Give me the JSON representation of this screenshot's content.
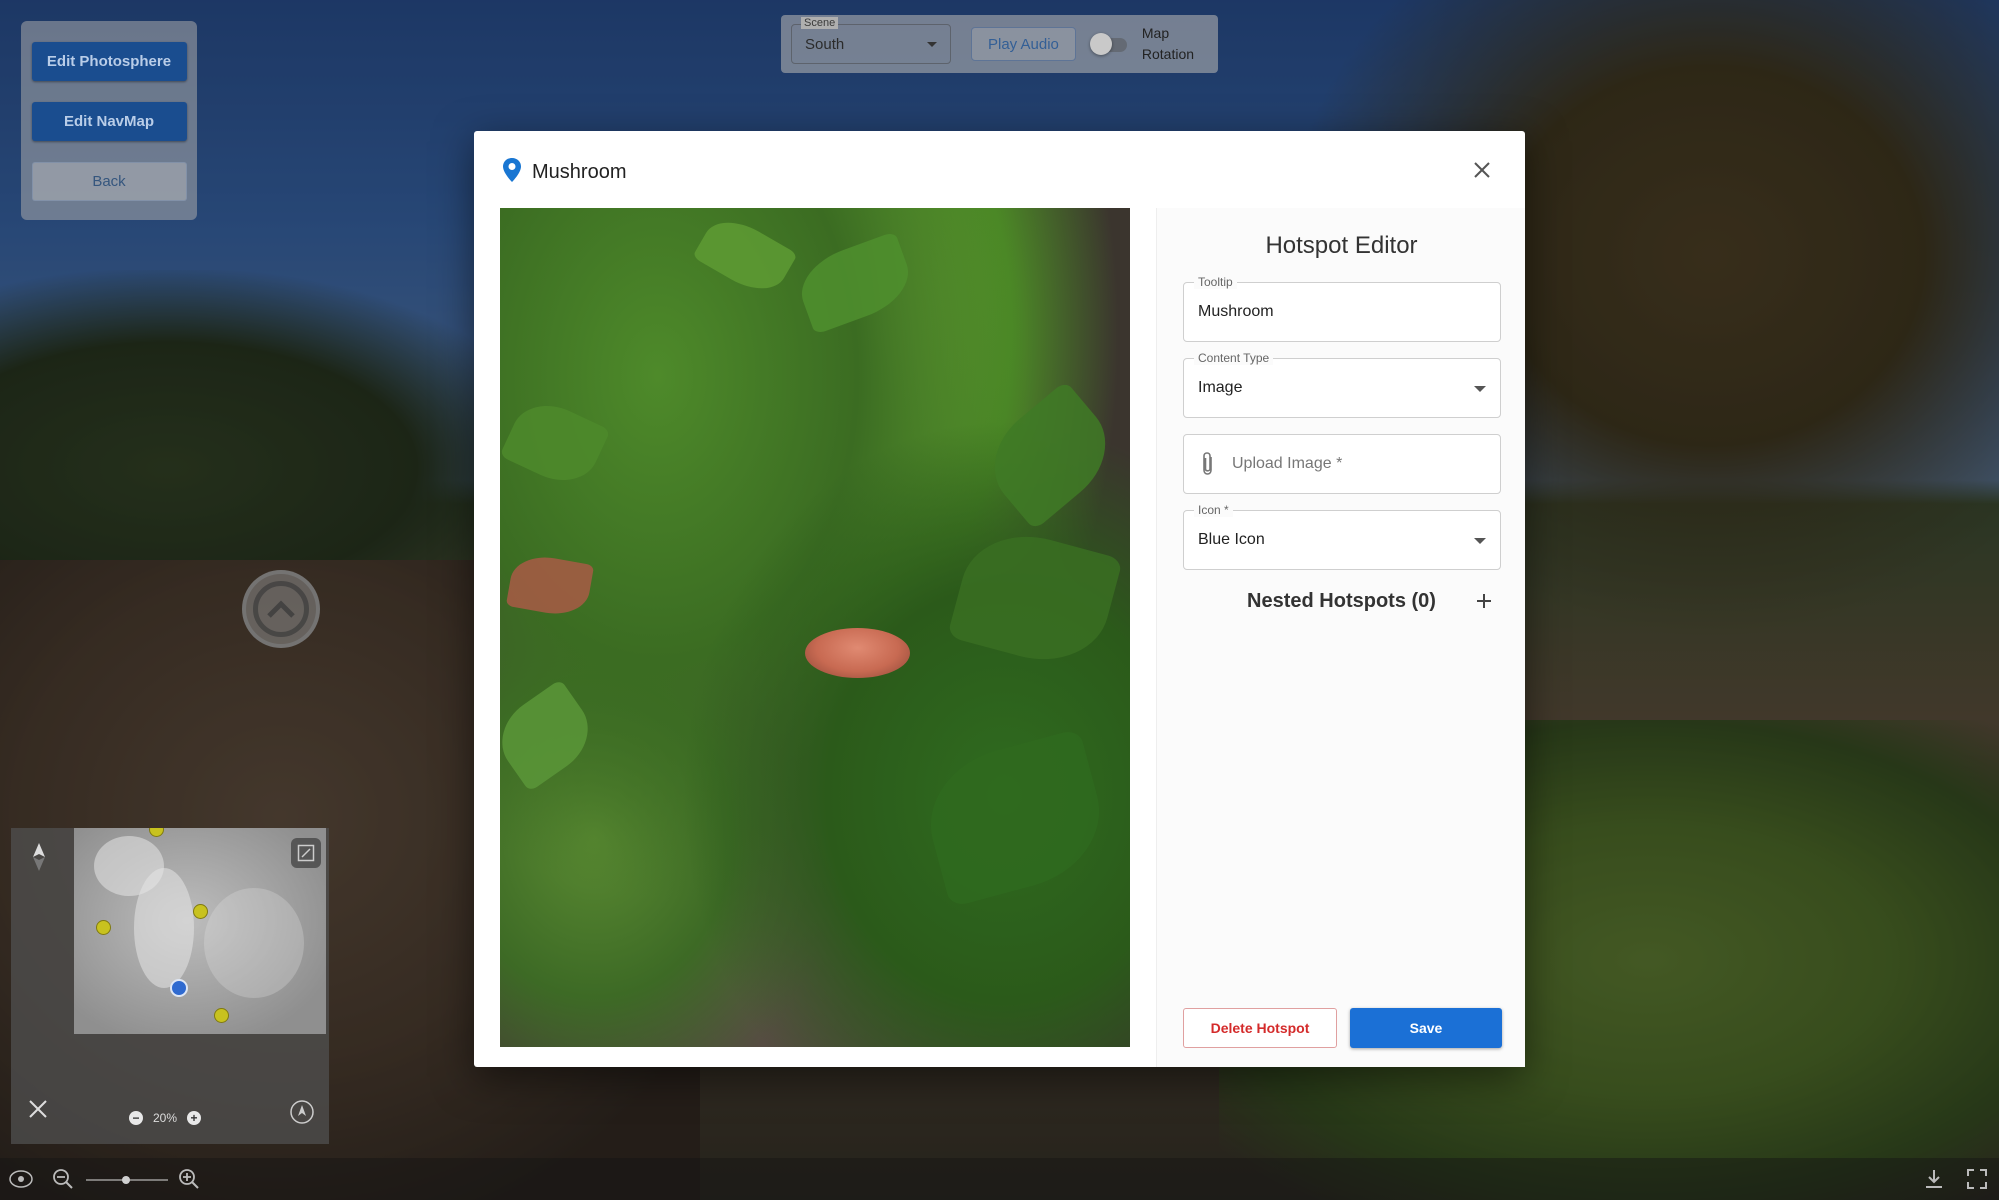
{
  "left_panel": {
    "edit_photosphere": "Edit Photosphere",
    "edit_navmap": "Edit NavMap",
    "back": "Back"
  },
  "top_bar": {
    "scene_label": "Scene",
    "scene_value": "South",
    "play_audio": "Play Audio",
    "map_rotation_line1": "Map",
    "map_rotation_line2": "Rotation",
    "map_rotation_enabled": false
  },
  "navmap": {
    "zoom_percent": "20%"
  },
  "modal": {
    "title": "Mushroom",
    "title_icon": "map-pin-icon",
    "photo_alt": "Mushroom hotspot image"
  },
  "editor": {
    "title": "Hotspot Editor",
    "tooltip_label": "Tooltip",
    "tooltip_value": "Mushroom",
    "content_type_label": "Content Type",
    "content_type_value": "Image",
    "upload_placeholder": "Upload Image *",
    "icon_label": "Icon *",
    "icon_value": "Blue Icon",
    "nested_hotspots": "Nested Hotspots (0)",
    "delete_label": "Delete Hotspot",
    "save_label": "Save"
  },
  "colors": {
    "primary": "#1b70d6",
    "danger": "#d42b2b",
    "pin": "#1976d2"
  }
}
